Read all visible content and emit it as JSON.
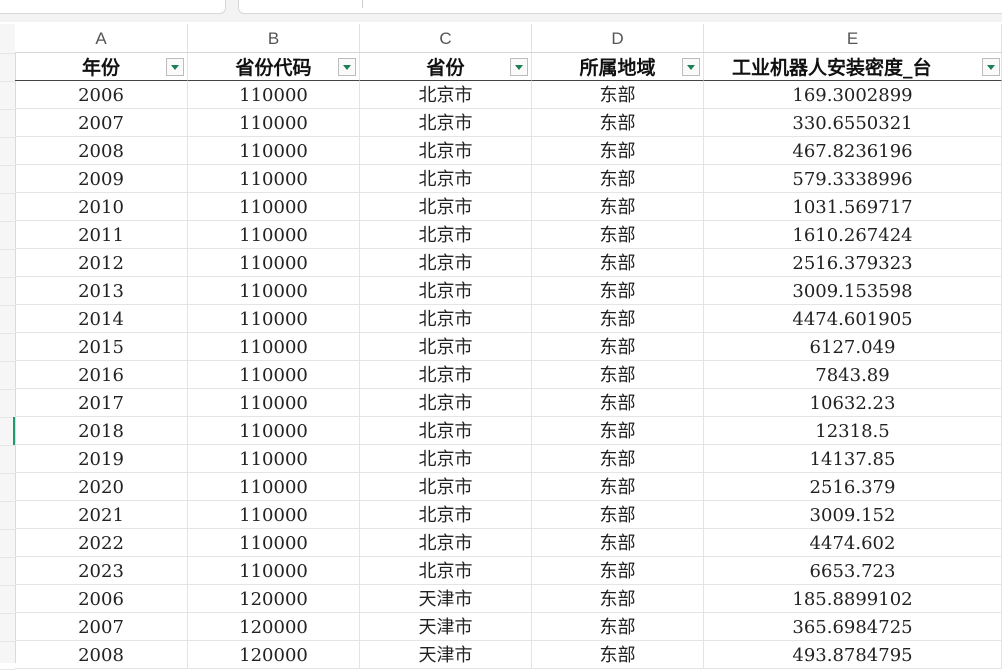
{
  "sheet": {
    "columns": [
      "A",
      "B",
      "C",
      "D",
      "E"
    ],
    "headers": [
      "年份",
      "省份代码",
      "省份",
      "所属地域",
      "工业机器人安装密度_台"
    ],
    "rows": [
      [
        "2006",
        "110000",
        "北京市",
        "东部",
        "169.3002899"
      ],
      [
        "2007",
        "110000",
        "北京市",
        "东部",
        "330.6550321"
      ],
      [
        "2008",
        "110000",
        "北京市",
        "东部",
        "467.8236196"
      ],
      [
        "2009",
        "110000",
        "北京市",
        "东部",
        "579.3338996"
      ],
      [
        "2010",
        "110000",
        "北京市",
        "东部",
        "1031.569717"
      ],
      [
        "2011",
        "110000",
        "北京市",
        "东部",
        "1610.267424"
      ],
      [
        "2012",
        "110000",
        "北京市",
        "东部",
        "2516.379323"
      ],
      [
        "2013",
        "110000",
        "北京市",
        "东部",
        "3009.153598"
      ],
      [
        "2014",
        "110000",
        "北京市",
        "东部",
        "4474.601905"
      ],
      [
        "2015",
        "110000",
        "北京市",
        "东部",
        "6127.049"
      ],
      [
        "2016",
        "110000",
        "北京市",
        "东部",
        "7843.89"
      ],
      [
        "2017",
        "110000",
        "北京市",
        "东部",
        "10632.23"
      ],
      [
        "2018",
        "110000",
        "北京市",
        "东部",
        "12318.5"
      ],
      [
        "2019",
        "110000",
        "北京市",
        "东部",
        "14137.85"
      ],
      [
        "2020",
        "110000",
        "北京市",
        "东部",
        "2516.379"
      ],
      [
        "2021",
        "110000",
        "北京市",
        "东部",
        "3009.152"
      ],
      [
        "2022",
        "110000",
        "北京市",
        "东部",
        "4474.602"
      ],
      [
        "2023",
        "110000",
        "北京市",
        "东部",
        "6653.723"
      ],
      [
        "2006",
        "120000",
        "天津市",
        "东部",
        "185.8899102"
      ],
      [
        "2007",
        "120000",
        "天津市",
        "东部",
        "365.6984725"
      ],
      [
        "2008",
        "120000",
        "天津市",
        "东部",
        "493.8784795"
      ]
    ]
  },
  "colors": {
    "filter_arrow": "#1a7f55",
    "selection_mark": "#1e9c6b"
  },
  "icons": {
    "filter": "filter-dropdown-icon"
  }
}
